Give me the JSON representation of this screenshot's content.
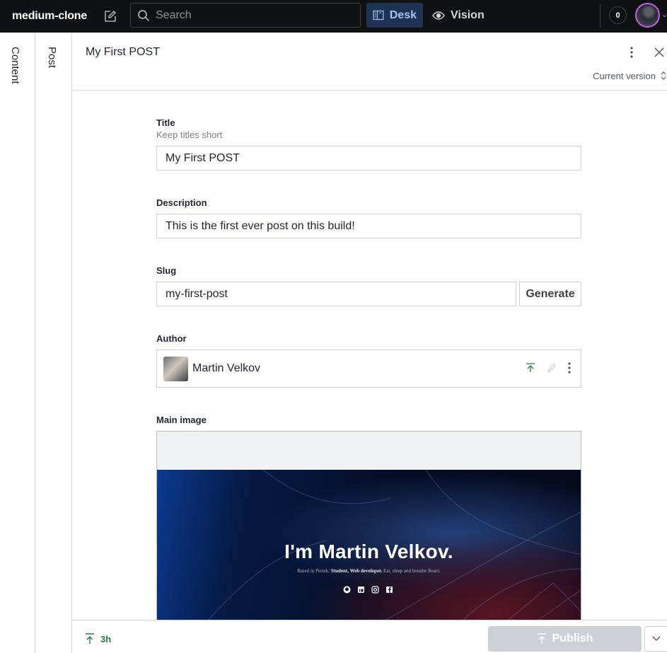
{
  "topbar": {
    "brand": "medium-clone",
    "search_placeholder": "Search",
    "tools": [
      {
        "label": "Desk",
        "icon": "desk-icon",
        "active": true
      },
      {
        "label": "Vision",
        "icon": "eye-icon",
        "active": false
      }
    ],
    "notification_count": "0"
  },
  "panes": {
    "content_label": "Content",
    "post_label": "Post"
  },
  "editor": {
    "document_title": "My First POST",
    "version_label": "Current version",
    "fields": {
      "title": {
        "label": "Title",
        "description": "Keep titles short",
        "value": "My First POST"
      },
      "description": {
        "label": "Description",
        "value": "This is the first ever post on this build!"
      },
      "slug": {
        "label": "Slug",
        "value": "my-first-post",
        "generate_label": "Generate"
      },
      "author": {
        "label": "Author",
        "name": "Martin Velkov"
      },
      "main_image": {
        "label": "Main image",
        "hero_title": "I'm Martin Velkov.",
        "hero_subtitle_prefix": "Based in Pernik. ",
        "hero_subtitle_bold": "Student, Web developer.",
        "hero_subtitle_suffix": " Eat, sleep and breathe React."
      }
    }
  },
  "footer": {
    "status_time": "3h",
    "publish_label": "Publish",
    "colors": {
      "published": "#2c7a3f",
      "publish_disabled": "#cdd1d7"
    }
  }
}
